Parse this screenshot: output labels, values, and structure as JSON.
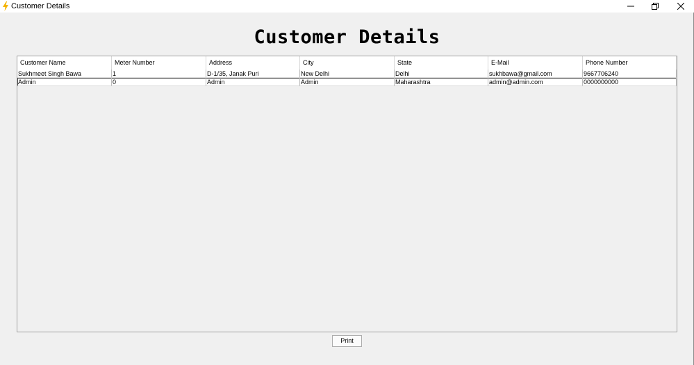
{
  "window": {
    "title": "Customer Details",
    "icon": "lightning-icon",
    "controls": [
      "minimize-icon",
      "restore-icon",
      "close-icon"
    ]
  },
  "page": {
    "heading": "Customer Details"
  },
  "table": {
    "columns": [
      "Customer Name",
      "Meter Number",
      "Address",
      "City",
      "State",
      "E-Mail",
      "Phone Number"
    ],
    "rows": [
      [
        "Sukhmeet Singh Bawa",
        "1",
        "D-1/35, Janak Puri",
        "New Delhi",
        "Delhi",
        "sukhbawa@gmail.com",
        "9667706240"
      ],
      [
        "Admin",
        "0",
        "Admin",
        "Admin",
        "Maharashtra",
        "admin@admin.com",
        "0000000000"
      ]
    ],
    "selected_row": 1
  },
  "actions": {
    "print_label": "Print"
  },
  "colors": {
    "background": "#f0f0f0",
    "table_background": "#ffffff",
    "icon_accent": "#f5b400"
  }
}
